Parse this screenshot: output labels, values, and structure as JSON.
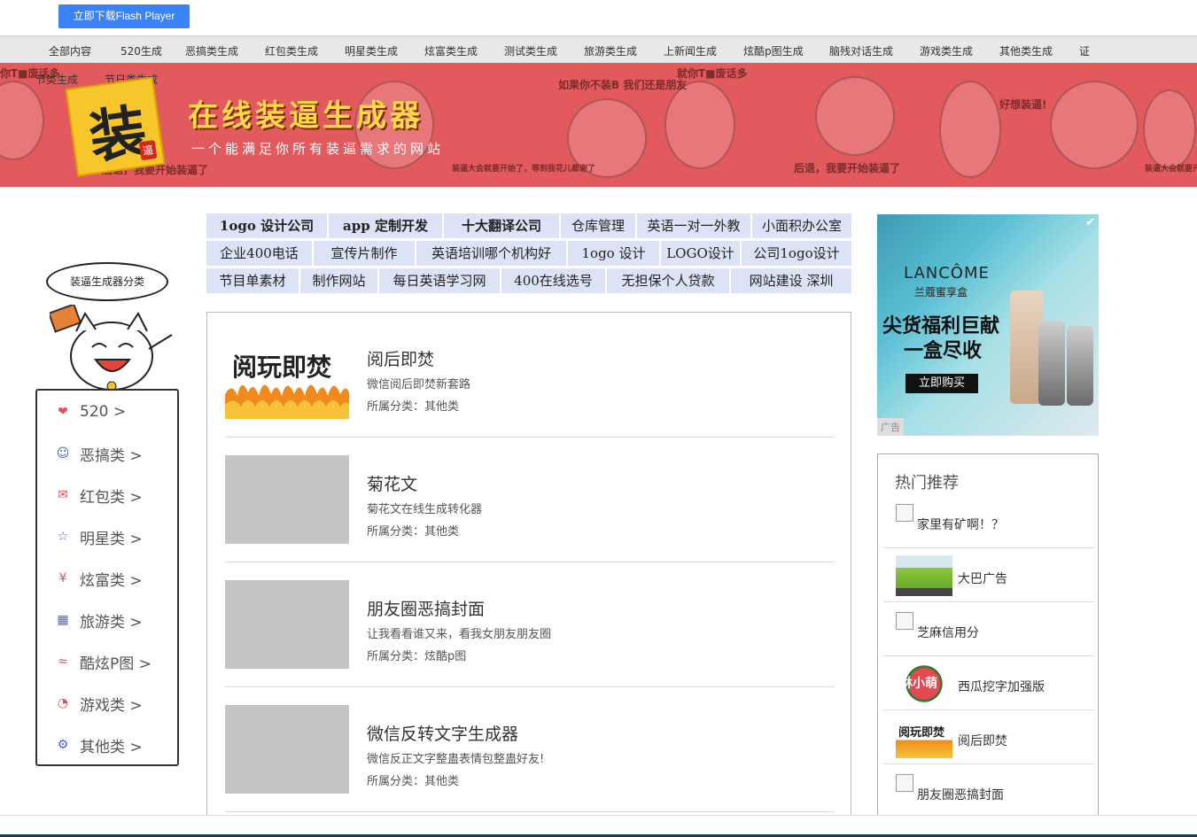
{
  "flash_button": "立即下载Flash Player",
  "topnav": {
    "items": [
      "全部内容",
      "520生成",
      "恶搞类生成",
      "红包类生成",
      "明星类生成",
      "炫富类生成",
      "测试类生成",
      "旅游类生成",
      "上新闻生成",
      "炫酷p图生成",
      "脑残对话生成",
      "游戏类生成",
      "其他类生成",
      "证"
    ],
    "row2": [
      "节类生成",
      "节日类生成"
    ]
  },
  "banner": {
    "logo_char": "装",
    "logo_sub": "逼",
    "title": "在线装逼生成器",
    "subtitle": "一个能满足你所有装逼需求的网站",
    "meme_texts": [
      "如果你不装B 我们还是朋友",
      "就你T■废话多",
      "好想装逼!",
      "后退，我要开始装逼了",
      "装逼大会就要开始了，等到我花儿都谢了",
      "装逼大会就要开",
      "后退，我要开始装逼了",
      "你T■废话多"
    ]
  },
  "sidebar": {
    "bubble": "装逼生成器分类",
    "items": [
      {
        "label": "520 >",
        "icon": "heart-icon",
        "color": "#e0505a"
      },
      {
        "label": "恶搞类 >",
        "icon": "funny-face-icon",
        "color": "#4a5fd8"
      },
      {
        "label": "红包类 >",
        "icon": "red-envelope-icon",
        "color": "#e0505a"
      },
      {
        "label": "明星类 >",
        "icon": "star-icon",
        "color": "#4a5fd8"
      },
      {
        "label": "炫富类 >",
        "icon": "money-icon",
        "color": "#e0505a"
      },
      {
        "label": "旅游类 >",
        "icon": "building-icon",
        "color": "#4a5fd8"
      },
      {
        "label": "酷炫P图 >",
        "icon": "wave-icon",
        "color": "#e0505a"
      },
      {
        "label": "游戏类 >",
        "icon": "chat-icon",
        "color": "#e0505a"
      },
      {
        "label": "其他类 >",
        "icon": "gear-icon",
        "color": "#4a5fd8"
      }
    ]
  },
  "ad_links": {
    "row1": [
      "1ogo 设计公司",
      "app 定制开发",
      "十大翻译公司",
      "仓库管理",
      "英语一对一外教",
      "小面积办公室"
    ],
    "row2": [
      "企业400电话",
      "宣传片制作",
      "英语培训哪个机构好",
      "1ogo 设计",
      "LOGO设计",
      "公司1ogo设计"
    ],
    "row3": [
      "节目单素材",
      "制作网站",
      "每日英语学习网",
      "400在线选号",
      "无担保个人贷款",
      "网站建设 深圳"
    ]
  },
  "entries": [
    {
      "title": "阅后即焚",
      "desc": "微信阅后即焚新套路",
      "category": "所属分类：其他类",
      "thumb_text": "阅玩即焚"
    },
    {
      "title": "菊花文",
      "desc": "菊花文在线生成转化器",
      "category": "所属分类：其他类",
      "thumb_text": ""
    },
    {
      "title": "朋友圈恶搞封面",
      "desc": "让我看看谁又来，看我女朋友朋友圈",
      "category": "所属分类：炫酷p图",
      "thumb_text": ""
    },
    {
      "title": "微信反转文字生成器",
      "desc": "微信反正文字整蛊表情包整蛊好友!",
      "category": "所属分类：其他类",
      "thumb_text": ""
    }
  ],
  "right_ad": {
    "brand": "LANCÔME",
    "brand_sub": "兰蔻蜜享盒",
    "headline1": "尖货福利巨献",
    "headline2": "一盒尽收",
    "buy": "立即购买",
    "ad_tag": "广告"
  },
  "hot": {
    "title": "热门推荐",
    "items": [
      "家里有矿啊！？",
      "大巴广告",
      "芝麻信用分",
      "西瓜挖字加强版",
      "阅后即焚",
      "朋友圈恶搞封面"
    ],
    "watermelon_text": "林小萌",
    "burn_text": "阅玩即焚"
  }
}
